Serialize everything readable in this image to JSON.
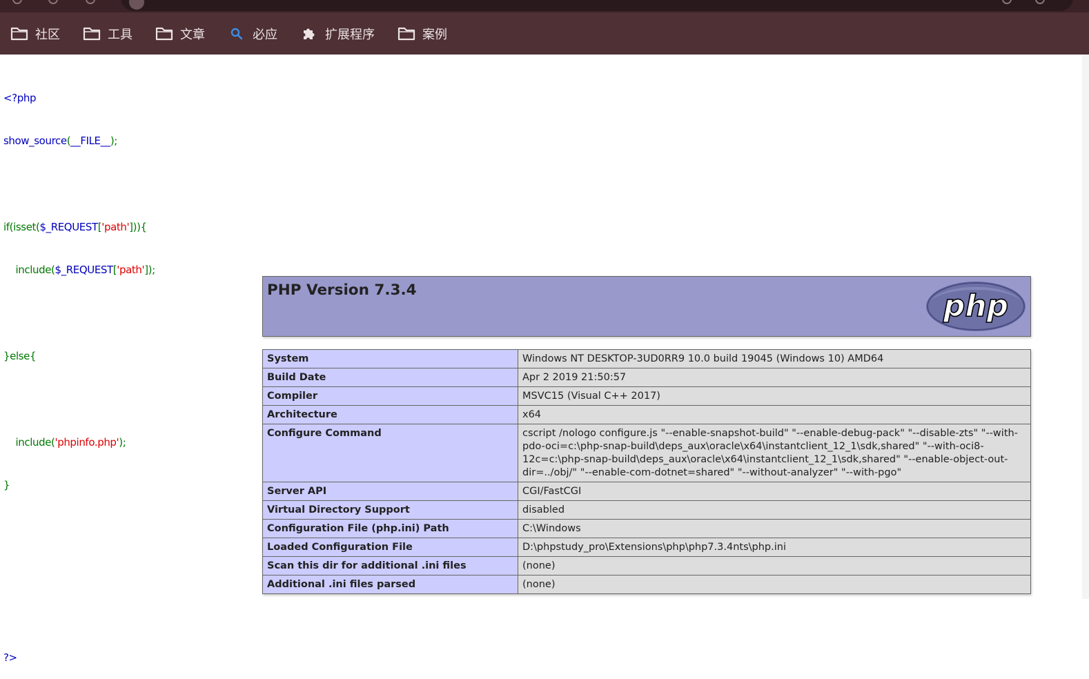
{
  "bookmarks": [
    {
      "label": "社区",
      "icon": "folder-icon"
    },
    {
      "label": "工具",
      "icon": "folder-icon"
    },
    {
      "label": "文章",
      "icon": "folder-icon"
    },
    {
      "label": "必应",
      "icon": "bing-search-icon"
    },
    {
      "label": "扩展程序",
      "icon": "puzzle-icon"
    },
    {
      "label": "案例",
      "icon": "folder-icon"
    }
  ],
  "source": {
    "open_tag": "<?php",
    "l2_fn": "show_source",
    "l2_open": "(",
    "l2_const": "__FILE__",
    "l2_close": ");",
    "l4_a": "if(isset(",
    "l4_var": "$_REQUEST",
    "l4_b": "[",
    "l4_str": "'path'",
    "l4_c": "])){",
    "l5_a": "include(",
    "l5_var": "$_REQUEST",
    "l5_b": "[",
    "l5_str": "'path'",
    "l5_c": "]);",
    "l7": "}else{",
    "l9_a": "include(",
    "l9_str": "'phpinfo.php'",
    "l9_c": ");",
    "l10": "}",
    "close_tag": "?>"
  },
  "phpinfo": {
    "title": "PHP Version 7.3.4",
    "logo_text": "php",
    "rows": [
      {
        "key": "System",
        "value": "Windows NT DESKTOP-3UD0RR9 10.0 build 19045 (Windows 10) AMD64"
      },
      {
        "key": "Build Date",
        "value": "Apr 2 2019 21:50:57"
      },
      {
        "key": "Compiler",
        "value": "MSVC15 (Visual C++ 2017)"
      },
      {
        "key": "Architecture",
        "value": "x64"
      },
      {
        "key": "Configure Command",
        "value": "cscript /nologo configure.js \"--enable-snapshot-build\" \"--enable-debug-pack\" \"--disable-zts\" \"--with-pdo-oci=c:\\php-snap-build\\deps_aux\\oracle\\x64\\instantclient_12_1\\sdk,shared\" \"--with-oci8-12c=c:\\php-snap-build\\deps_aux\\oracle\\x64\\instantclient_12_1\\sdk,shared\" \"--enable-object-out-dir=../obj/\" \"--enable-com-dotnet=shared\" \"--without-analyzer\" \"--with-pgo\""
      },
      {
        "key": "Server API",
        "value": "CGI/FastCGI"
      },
      {
        "key": "Virtual Directory Support",
        "value": "disabled"
      },
      {
        "key": "Configuration File (php.ini) Path",
        "value": "C:\\Windows"
      },
      {
        "key": "Loaded Configuration File",
        "value": "D:\\phpstudy_pro\\Extensions\\php\\php7.3.4nts\\php.ini"
      },
      {
        "key": "Scan this dir for additional .ini files",
        "value": "(none)"
      },
      {
        "key": "Additional .ini files parsed",
        "value": "(none)"
      }
    ]
  },
  "colors": {
    "bookmark_bar": "#4e3035",
    "code_default": "#0000BB",
    "code_keyword": "#007700",
    "code_string": "#DD0000",
    "info_header": "#9999cc",
    "info_key_cell": "#ccccff",
    "info_value_cell": "#dddddd"
  }
}
